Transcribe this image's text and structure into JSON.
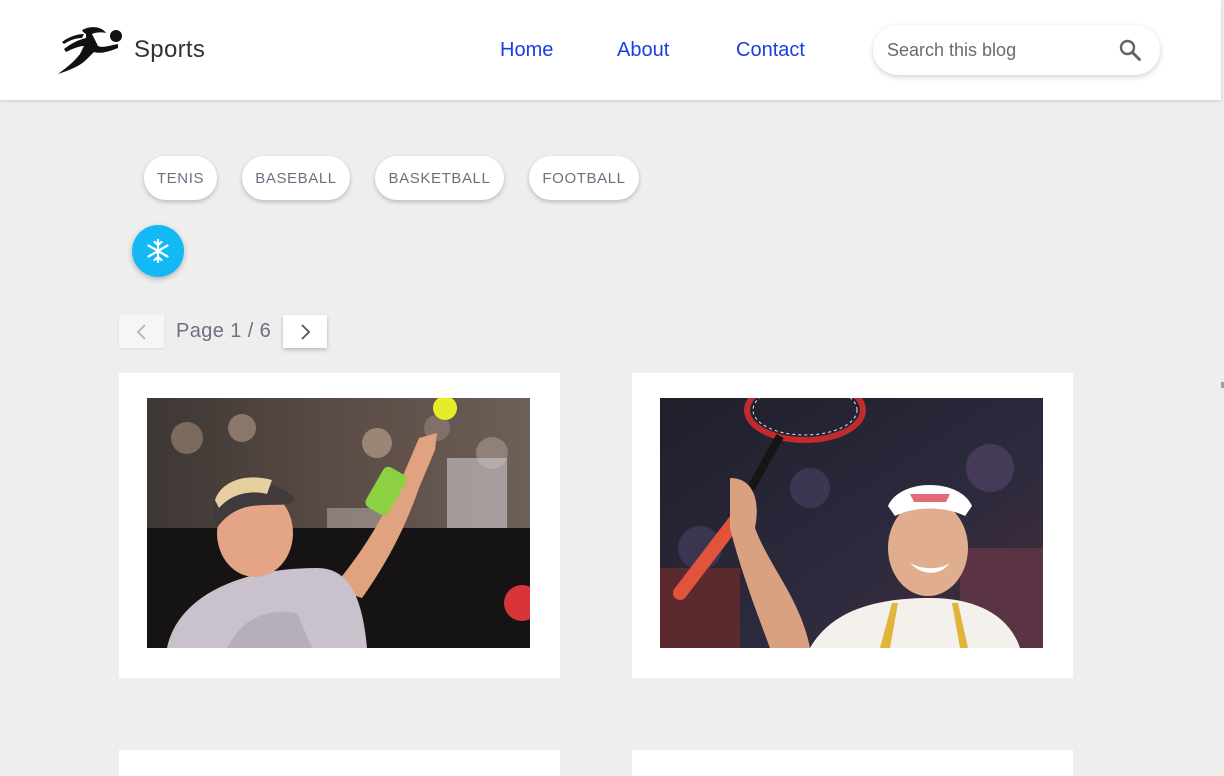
{
  "header": {
    "site_title": "Sports",
    "logo_icon": "runner-logo-icon",
    "nav": [
      {
        "label": "Home"
      },
      {
        "label": "About"
      },
      {
        "label": "Contact"
      }
    ],
    "search": {
      "placeholder": "Search this blog",
      "value": "",
      "icon": "search-icon"
    }
  },
  "categories": [
    {
      "label": "TENIS"
    },
    {
      "label": "BASEBALL"
    },
    {
      "label": "BASKETBALL"
    },
    {
      "label": "FOOTBALL"
    }
  ],
  "fab": {
    "icon": "snowflake-icon",
    "color": "#13b9f5"
  },
  "pagination": {
    "text": "Page 1 / 6",
    "current": 1,
    "total": 6,
    "prev_icon": "chevron-left-icon",
    "next_icon": "chevron-right-icon"
  },
  "posts": [
    {
      "image_subject": "male tennis player serving"
    },
    {
      "image_subject": "female tennis player celebrating with racket"
    },
    {
      "image_subject": ""
    },
    {
      "image_subject": ""
    }
  ],
  "colors": {
    "nav_link": "#1a3fe0",
    "page_background": "#eeeeee",
    "chip_text": "#6e7080"
  }
}
